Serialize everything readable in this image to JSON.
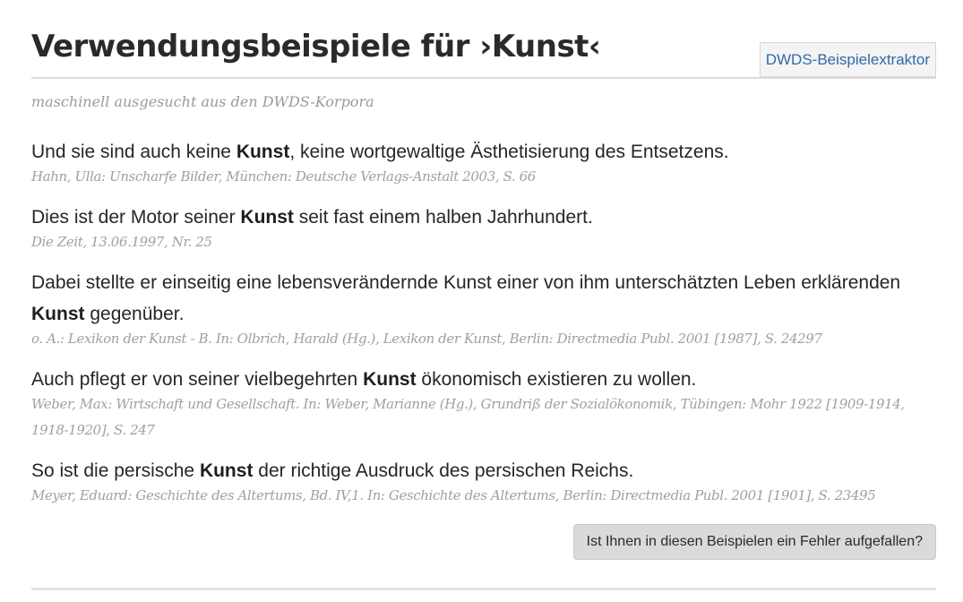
{
  "header": {
    "title": "Verwendungsbeispiele für ›Kunst‹",
    "extractor_label": "DWDS-Beispielextraktor"
  },
  "subtitle": "maschinell ausgesucht aus den DWDS-Korpora",
  "examples": [
    {
      "before": "Und sie sind auch keine ",
      "keyword": "Kunst",
      "after": ", keine wortgewaltige Ästhetisierung des Entsetzens.",
      "source": "Hahn, Ulla: Unscharfe Bilder, München: Deutsche Verlags-Anstalt 2003, S. 66"
    },
    {
      "before": "Dies ist der Motor seiner ",
      "keyword": "Kunst",
      "after": " seit fast einem halben Jahrhundert.",
      "source": "Die Zeit, 13.06.1997, Nr. 25"
    },
    {
      "before": "Dabei stellte er einseitig eine lebensverändernde Kunst einer von ihm unterschätzten Leben erklärenden ",
      "keyword": "Kunst",
      "after": " gegenüber.",
      "source": "o. A.: Lexikon der Kunst - B. In: Olbrich, Harald (Hg.), Lexikon der Kunst, Berlin: Directmedia Publ. 2001 [1987], S. 24297"
    },
    {
      "before": "Auch pflegt er von seiner vielbegehrten ",
      "keyword": "Kunst",
      "after": " ökonomisch existieren zu wollen.",
      "source": "Weber, Max: Wirtschaft und Gesellschaft. In: Weber, Marianne (Hg.), Grundriß der Sozialökonomik, Tübingen: Mohr 1922 [1909-1914, 1918-1920], S. 247"
    },
    {
      "before": "So ist die persische ",
      "keyword": "Kunst",
      "after": " der richtige Ausdruck des persischen Reichs.",
      "source": "Meyer, Eduard: Geschichte des Altertums, Bd. IV,1. In: Geschichte des Altertums, Berlin: Directmedia Publ. 2001 [1901], S. 23495"
    }
  ],
  "report_button_label": "Ist Ihnen in diesen Beispielen ein Fehler aufgefallen?"
}
